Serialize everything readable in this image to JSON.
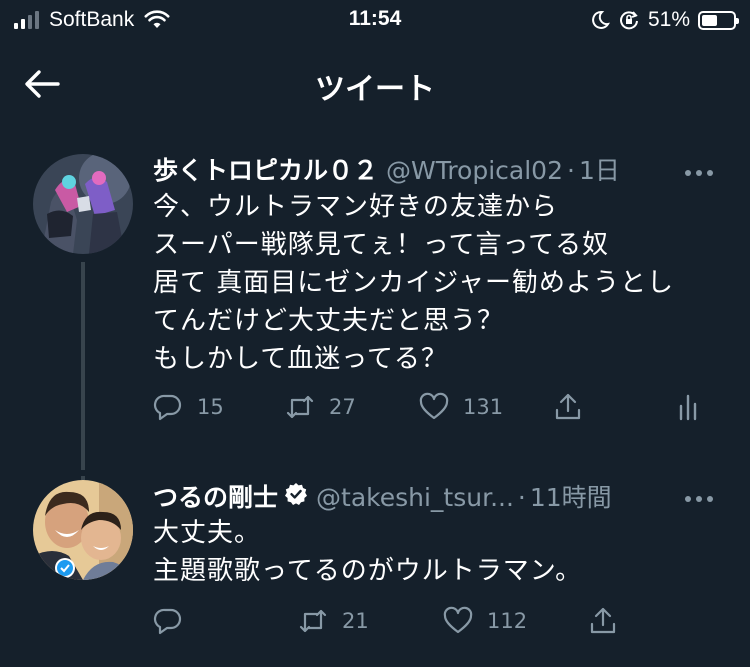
{
  "status_bar": {
    "carrier": "SoftBank",
    "time": "11:54",
    "battery_percent": "51%",
    "battery_level": 0.51
  },
  "header": {
    "title": "ツイート"
  },
  "tweets": [
    {
      "display_name": "歩くトロピカル０２",
      "handle": "@WTropical02",
      "separator": "·",
      "time": "1日",
      "text": "今、ウルトラマン好きの友達から\nスーパー戦隊見てぇ！って言ってる奴\n居て 真面目にゼンカイジャー勧めようとし\nてんだけど大丈夫だと思う？\nもしかして血迷ってる？",
      "reply_count": "15",
      "retweet_count": "27",
      "like_count": "131"
    },
    {
      "display_name": "つるの剛士",
      "handle": "@takeshi_tsur...",
      "separator": "·",
      "time": "11時間",
      "text": "大丈夫。\n主題歌歌ってるのがウルトラマン。",
      "reply_count": "",
      "retweet_count": "21",
      "like_count": "112"
    }
  ],
  "colors": {
    "background": "#15202b",
    "secondary_text": "#8899a6",
    "verified_badge": "#ffffff"
  }
}
